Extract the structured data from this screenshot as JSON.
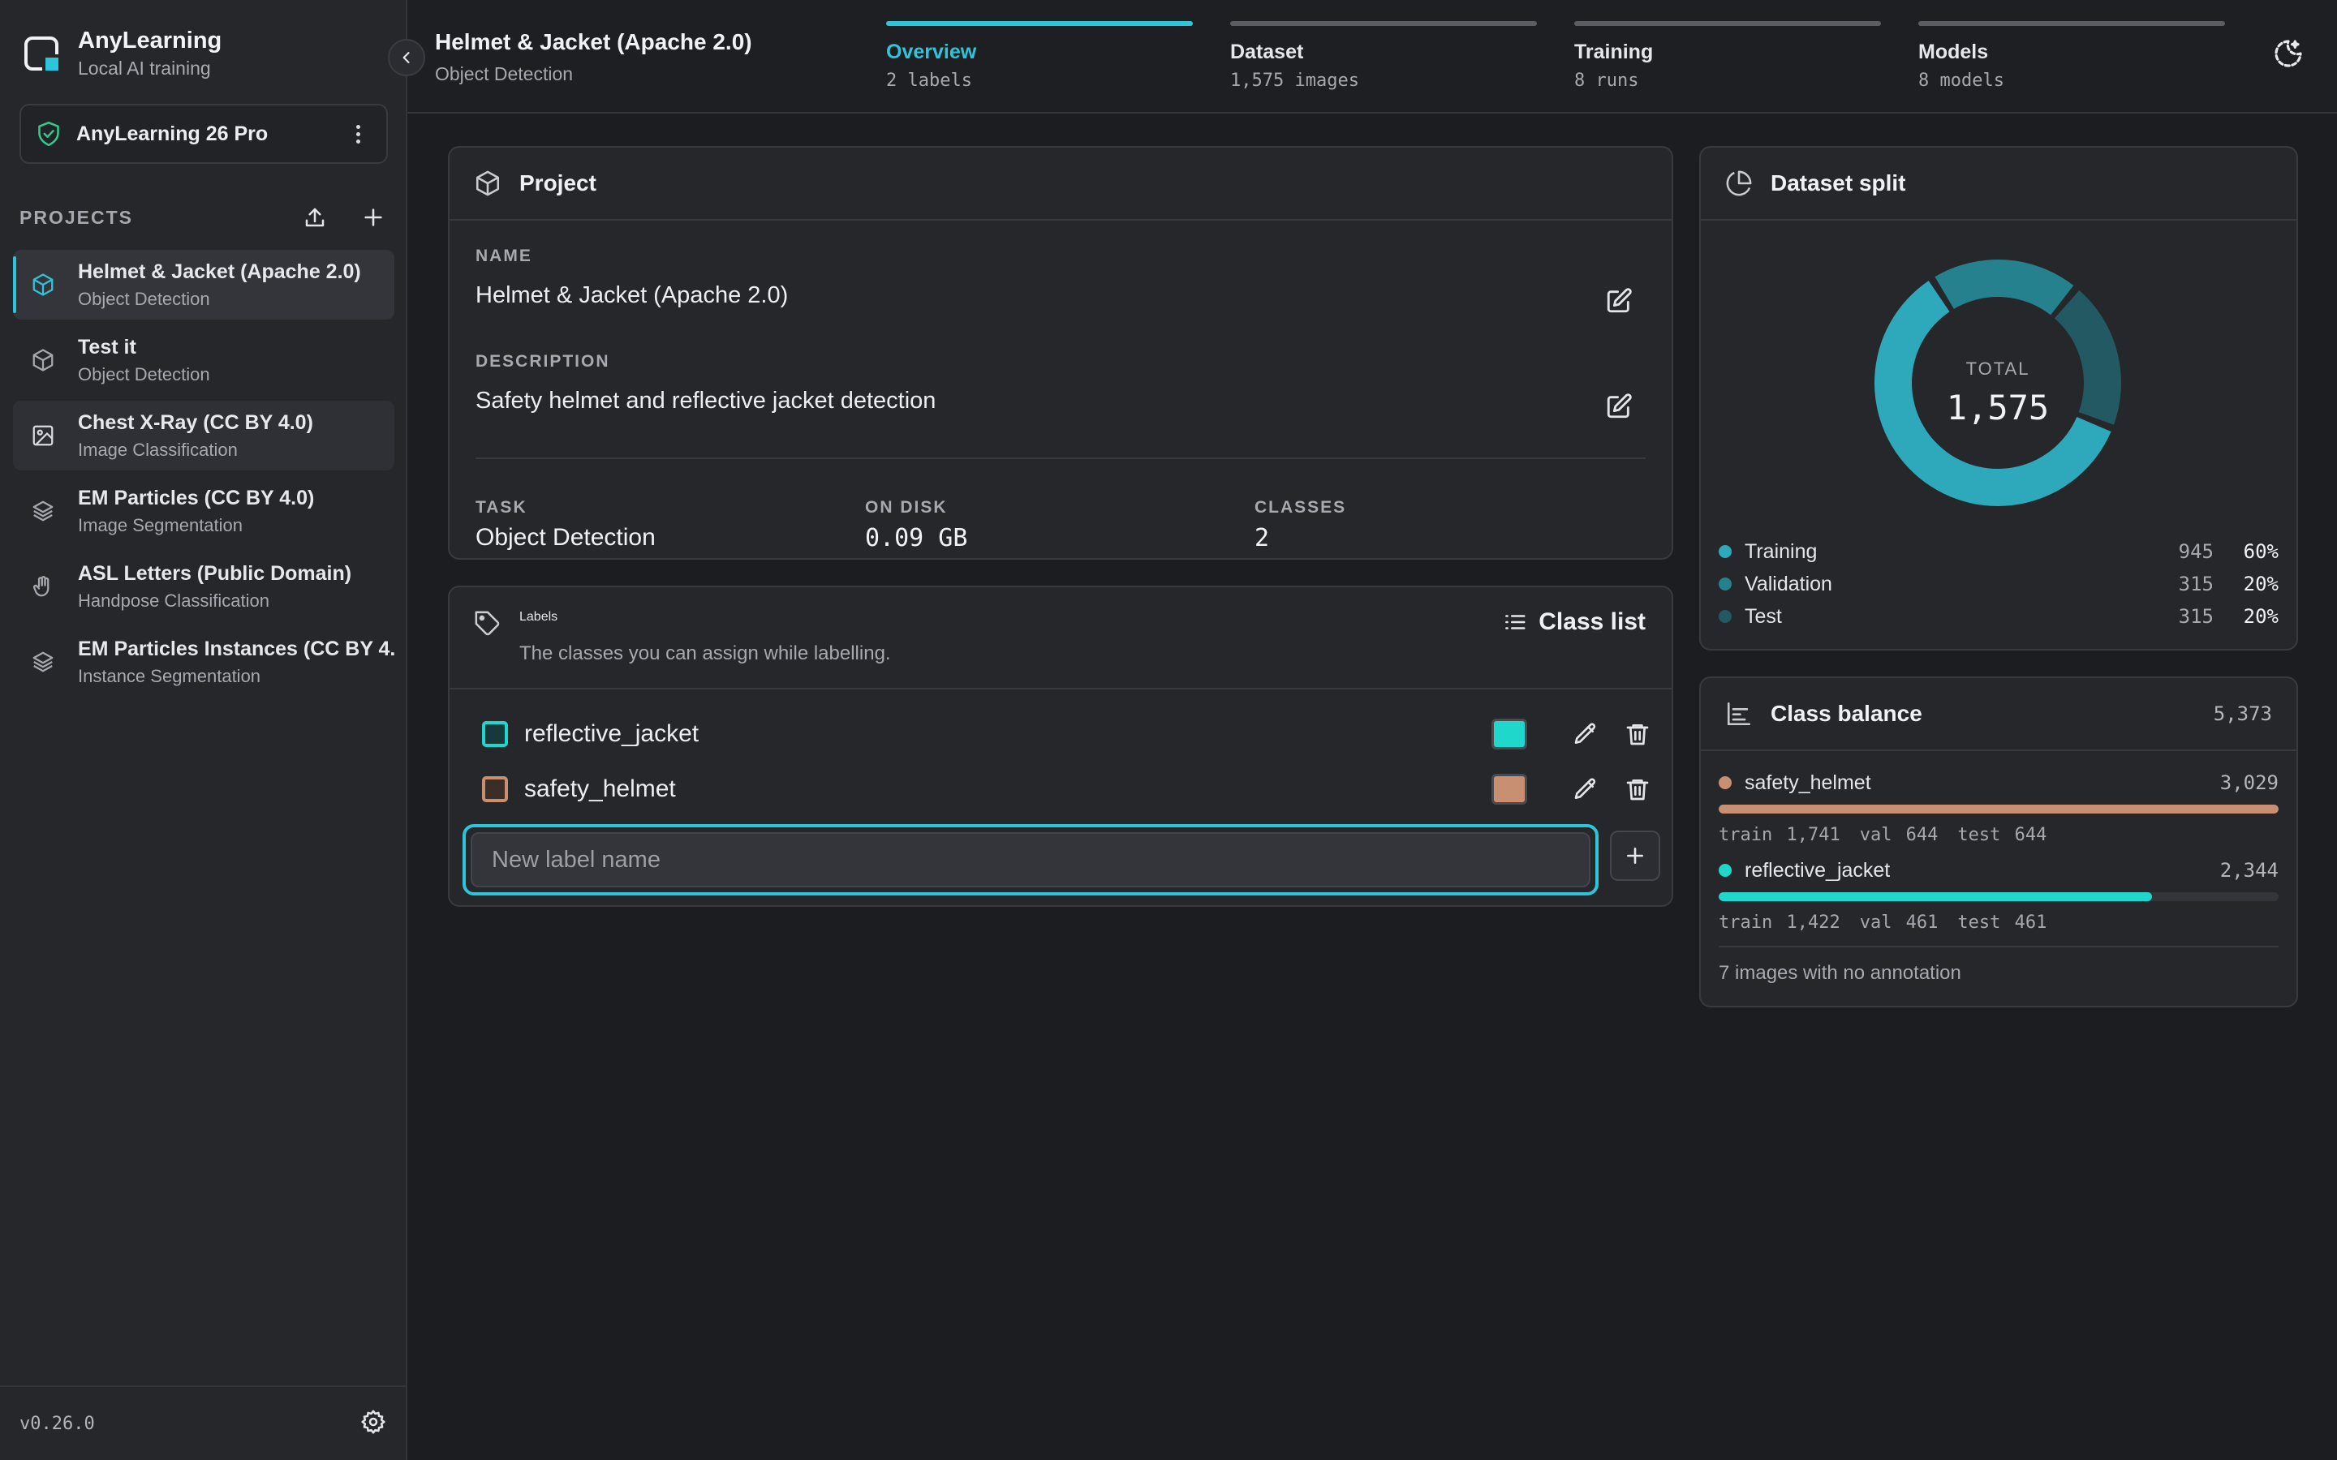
{
  "brand": {
    "name": "AnyLearning",
    "subtitle": "Local AI training"
  },
  "license": {
    "name": "AnyLearning 26 Pro"
  },
  "sidebar": {
    "projects_heading": "PROJECTS",
    "projects": [
      {
        "name": "Helmet & Jacket (Apache 2.0)",
        "type": "Object Detection",
        "icon": "cube-icon"
      },
      {
        "name": "Test it",
        "type": "Object Detection",
        "icon": "cube-icon"
      },
      {
        "name": "Chest X-Ray (CC BY 4.0)",
        "type": "Image Classification",
        "icon": "image-icon"
      },
      {
        "name": "EM Particles (CC BY 4.0)",
        "type": "Image Segmentation",
        "icon": "layers-icon"
      },
      {
        "name": "ASL Letters (Public Domain)",
        "type": "Handpose Classification",
        "icon": "hand-icon"
      },
      {
        "name": "EM Particles Instances (CC BY 4.0)",
        "type": "Instance Segmentation",
        "icon": "layers-icon"
      }
    ],
    "version": "v0.26.0"
  },
  "header": {
    "title": "Helmet & Jacket (Apache 2.0)",
    "subtitle": "Object Detection",
    "tabs": [
      {
        "label": "Overview",
        "count": "2 labels"
      },
      {
        "label": "Dataset",
        "count": "1,575 images"
      },
      {
        "label": "Training",
        "count": "8 runs"
      },
      {
        "label": "Models",
        "count": "8 models"
      }
    ]
  },
  "project_card": {
    "title": "Project",
    "name_label": "NAME",
    "name_value": "Helmet & Jacket (Apache 2.0)",
    "description_label": "DESCRIPTION",
    "description_value": "Safety helmet and reflective jacket detection",
    "task_label": "TASK",
    "task_value": "Object Detection",
    "disk_label": "ON DISK",
    "disk_value": "0.09 GB",
    "classes_label": "CLASSES",
    "classes_value": "2"
  },
  "labels_card": {
    "title": "Labels",
    "subtitle": "The classes you can assign while labelling.",
    "class_list_label": "Class list",
    "labels": [
      {
        "name": "reflective_jacket",
        "color": "#1fd8cb"
      },
      {
        "name": "safety_helmet",
        "color": "#c98f73"
      }
    ],
    "new_label_placeholder": "New label name"
  },
  "split_card": {
    "title": "Dataset split",
    "total_label": "TOTAL",
    "total_value": "1,575",
    "rows": [
      {
        "name": "Training",
        "count": "945",
        "pct": "60%",
        "color": "#2ea9bb",
        "fraction": 0.6
      },
      {
        "name": "Validation",
        "count": "315",
        "pct": "20%",
        "color": "#26818f",
        "fraction": 0.2
      },
      {
        "name": "Test",
        "count": "315",
        "pct": "20%",
        "color": "#235963",
        "fraction": 0.2
      }
    ]
  },
  "balance_card": {
    "title": "Class balance",
    "total": "5,373",
    "rows": [
      {
        "name": "safety_helmet",
        "count": "3,029",
        "color": "#c98f73",
        "fraction": 1.0,
        "train": "train 1,741",
        "val": "val 644",
        "test": "test 644"
      },
      {
        "name": "reflective_jacket",
        "count": "2,344",
        "color": "#1fd8cb",
        "fraction": 0.774,
        "train": "train 1,422",
        "val": "val 461",
        "test": "test 461"
      }
    ],
    "no_annotation": "7 images with no annotation"
  }
}
